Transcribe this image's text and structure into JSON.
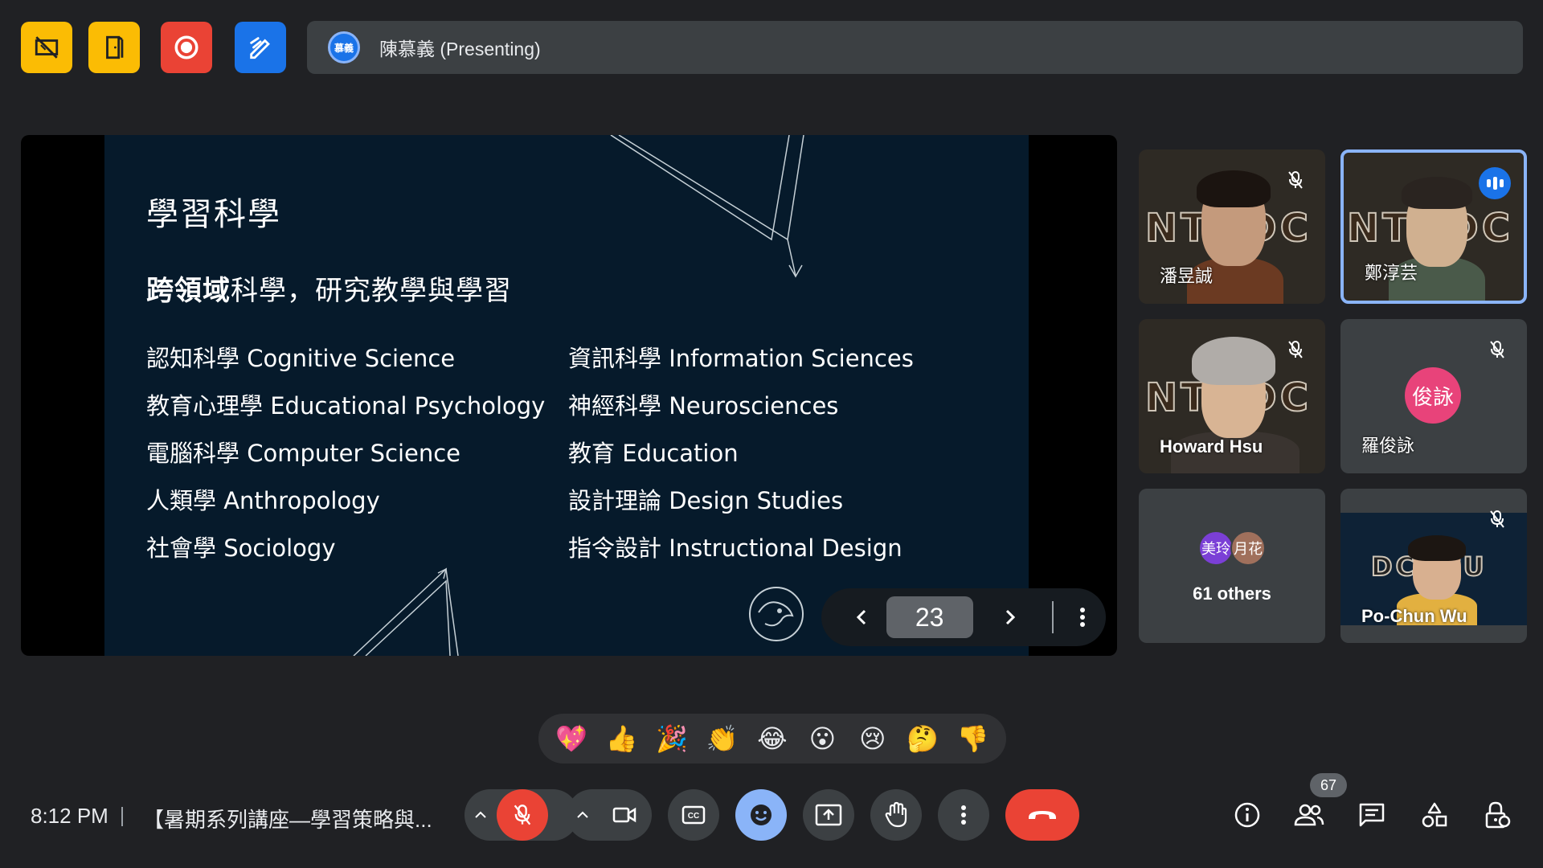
{
  "top_apps": [
    {
      "name": "whiteboard-app",
      "color": "#fbbc04"
    },
    {
      "name": "breakout-rooms-app",
      "color": "#fbbc04"
    },
    {
      "name": "recording-app",
      "color": "#ea4335"
    },
    {
      "name": "annotate-app",
      "color": "#1a73e8"
    }
  ],
  "presenter": {
    "avatar_text": "慕義",
    "label": "陳慕義 (Presenting)"
  },
  "slide": {
    "title": "學習科學",
    "subtitle_bold": "跨領域",
    "subtitle_rest": "科學，研究教學與學習",
    "left_fields": [
      "認知科學 Cognitive Science",
      "教育心理學 Educational Psychology",
      "電腦科學 Computer Science",
      "人類學 Anthropology",
      "社會學 Sociology"
    ],
    "right_fields": [
      "資訊科學 Information Sciences",
      "神經科學 Neurosciences",
      "教育 Education",
      "設計理論 Design Studies",
      "指令設計 Instructional Design"
    ],
    "page_number": "23"
  },
  "participants": [
    {
      "name": "潘昱誠",
      "muted": true
    },
    {
      "name": "鄭淳芸",
      "speaking": true
    },
    {
      "name": "Howard Hsu",
      "muted": true
    },
    {
      "name": "羅俊詠",
      "muted": true,
      "avatar_text": "俊詠"
    },
    {
      "name": "Po-Chun Wu",
      "muted": true
    }
  ],
  "others": {
    "avatar1": "美玲",
    "avatar2": "月花",
    "label": "61 others"
  },
  "reactions": [
    "💖",
    "👍",
    "🎉",
    "👏",
    "😂",
    "😮",
    "😢",
    "🤔",
    "👎"
  ],
  "bottom_bar": {
    "time": "8:12 PM",
    "meeting_title": "【暑期系列講座—學習策略與...",
    "people_count": "67"
  },
  "colors": {
    "end_call": "#ea4335",
    "mic_off": "#ea4335",
    "reactions_active": "#8ab4f8",
    "speaking_border": "#8ab4f8"
  }
}
